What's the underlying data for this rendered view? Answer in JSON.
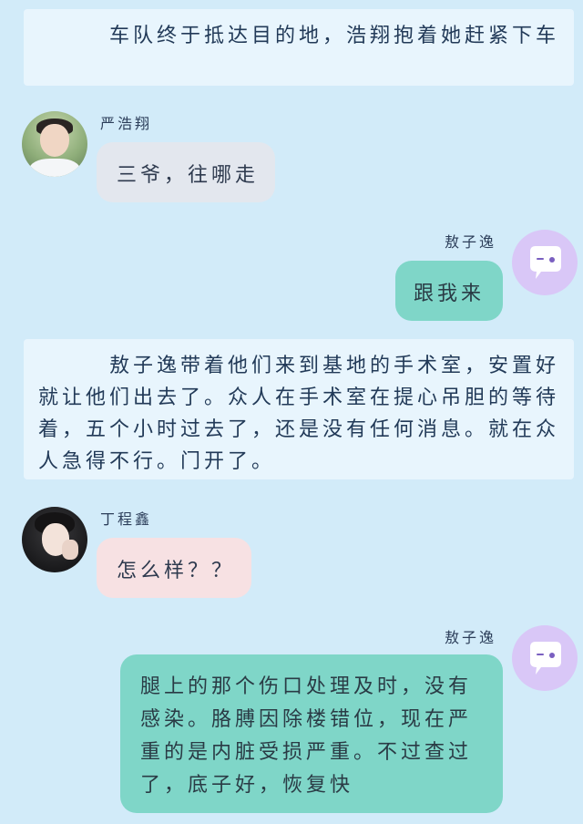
{
  "narrations": [
    {
      "text": "车队终于抵达目的地，浩翔抱着她赶紧下车"
    },
    {
      "text": "敖子逸带着他们来到基地的手术室，安置好就让他们出去了。众人在手术室在提心吊胆的等待着，五个小时过去了，还是没有任何消息。就在众人急得不行。门开了。"
    }
  ],
  "messages": [
    {
      "speaker": "严浩翔",
      "text": "三爷，往哪走",
      "side": "left"
    },
    {
      "speaker": "敖子逸",
      "text": "跟我来",
      "side": "right"
    },
    {
      "speaker": "丁程鑫",
      "text": "怎么样？？",
      "side": "left"
    },
    {
      "speaker": "敖子逸",
      "text": "腿上的那个伤口处理及时，没有感染。胳膊因除楼错位，现在严重的是内脏受损严重。不过查过了，底子好，恢复快",
      "side": "right"
    }
  ],
  "colors": {
    "background": "#d2ebf9",
    "narration": "#e8f5fd",
    "bubble_gray": "#e3e7ee",
    "bubble_pink": "#f7e1e3",
    "bubble_teal": "#7fd6c8",
    "bot_avatar": "#d9c7f7"
  },
  "icons": {
    "bot_avatar": "chat-bubble-wink-icon"
  }
}
